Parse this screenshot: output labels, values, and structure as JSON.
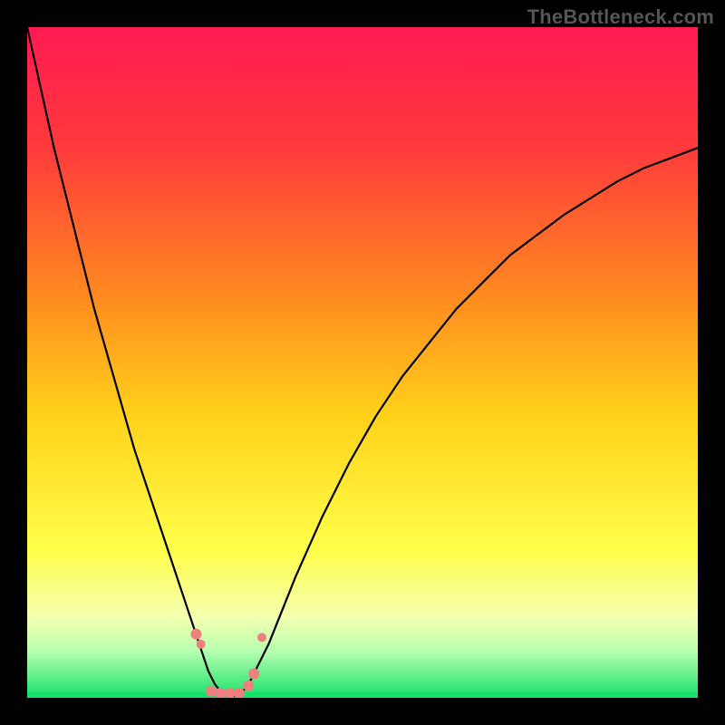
{
  "watermark": "TheBottleneck.com",
  "chart_data": {
    "type": "line",
    "title": "",
    "xlabel": "",
    "ylabel": "",
    "xlim": [
      0,
      100
    ],
    "ylim": [
      0,
      100
    ],
    "background_gradient": {
      "stops": [
        {
          "offset": 0.0,
          "color": "#ff1a52"
        },
        {
          "offset": 0.18,
          "color": "#ff3a3c"
        },
        {
          "offset": 0.4,
          "color": "#ff8a1f"
        },
        {
          "offset": 0.58,
          "color": "#ffd21a"
        },
        {
          "offset": 0.78,
          "color": "#ffff4a"
        },
        {
          "offset": 0.88,
          "color": "#f4ffb0"
        },
        {
          "offset": 0.93,
          "color": "#b8ffb0"
        },
        {
          "offset": 1.0,
          "color": "#16e06a"
        }
      ]
    },
    "series": [
      {
        "name": "bottleneck-curve",
        "color": "#000000",
        "stroke_width": 2.2,
        "x": [
          0,
          2,
          4,
          6,
          8,
          10,
          12,
          14,
          16,
          18,
          20,
          22,
          24,
          25,
          26,
          27,
          28,
          29,
          30,
          31,
          32,
          33,
          34,
          36,
          38,
          40,
          44,
          48,
          52,
          56,
          60,
          64,
          68,
          72,
          76,
          80,
          84,
          88,
          92,
          96,
          100
        ],
        "y": [
          100,
          91,
          82,
          74,
          66,
          58,
          51,
          44,
          37,
          31,
          25,
          19,
          13,
          10,
          7,
          4,
          2,
          0.8,
          0.3,
          0.3,
          0.8,
          2,
          4,
          8,
          13,
          18,
          27,
          35,
          42,
          48,
          53,
          58,
          62,
          66,
          69,
          72,
          74.5,
          77,
          79,
          80.5,
          82
        ]
      }
    ],
    "markers": {
      "color": "#f08080",
      "points": [
        {
          "x": 25.2,
          "y": 9.5,
          "r": 6
        },
        {
          "x": 25.9,
          "y": 8.0,
          "r": 5
        },
        {
          "x": 27.4,
          "y": 1.0,
          "r": 6
        },
        {
          "x": 28.8,
          "y": 0.7,
          "r": 6
        },
        {
          "x": 30.2,
          "y": 0.7,
          "r": 6
        },
        {
          "x": 31.6,
          "y": 0.7,
          "r": 6
        },
        {
          "x": 33.0,
          "y": 1.8,
          "r": 6
        },
        {
          "x": 33.8,
          "y": 3.6,
          "r": 6
        },
        {
          "x": 35.0,
          "y": 9.0,
          "r": 5
        }
      ]
    }
  }
}
